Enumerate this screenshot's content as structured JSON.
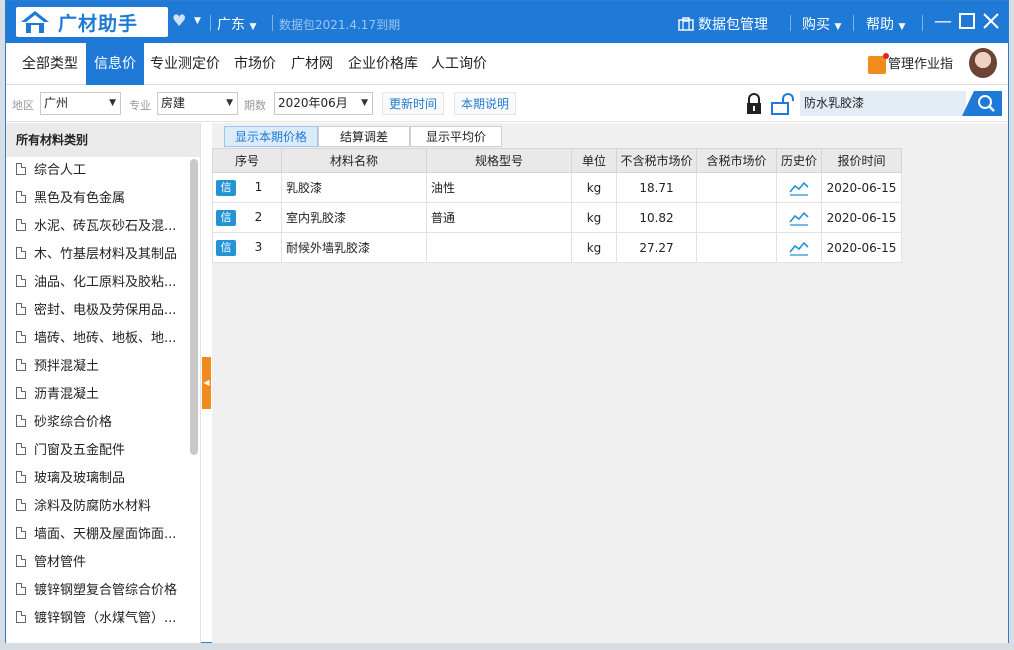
{
  "titlebar": {
    "app_name": "广材助手",
    "region": "广东",
    "datapkg_info": "数据包2021.4.17到期",
    "datapkg_mgmt": "数据包管理",
    "buy": "购买",
    "help": "帮助"
  },
  "nav": {
    "tabs": [
      {
        "label": "全部类型"
      },
      {
        "label": "信息价"
      },
      {
        "label": "专业测定价"
      },
      {
        "label": "市场价"
      },
      {
        "label": "广材网"
      },
      {
        "label": "企业价格库"
      },
      {
        "label": "人工询价"
      }
    ],
    "mgmt_label": "管理作业指"
  },
  "filters": {
    "region_label": "地区",
    "region_value": "广州",
    "major_label": "专业",
    "major_value": "房建",
    "period_label": "期数",
    "period_value": "2020年06月",
    "update_time": "更新时间",
    "period_note": "本期说明",
    "search_value": "防水乳胶漆"
  },
  "sidebar": {
    "header": "所有材料类别",
    "items": [
      {
        "label": "综合人工"
      },
      {
        "label": "黑色及有色金属"
      },
      {
        "label": "水泥、砖瓦灰砂石及混..."
      },
      {
        "label": "木、竹基层材料及其制品"
      },
      {
        "label": "油品、化工原料及胶粘..."
      },
      {
        "label": "密封、电极及劳保用品..."
      },
      {
        "label": "墙砖、地砖、地板、地..."
      },
      {
        "label": "预拌混凝土"
      },
      {
        "label": "沥青混凝土"
      },
      {
        "label": "砂浆综合价格"
      },
      {
        "label": "门窗及五金配件"
      },
      {
        "label": "玻璃及玻璃制品"
      },
      {
        "label": "涂料及防腐防水材料"
      },
      {
        "label": "墙面、天棚及屋面饰面..."
      },
      {
        "label": "管材管件"
      },
      {
        "label": "镀锌钢塑复合管综合价格"
      },
      {
        "label": "镀锌钢管（水煤气管）..."
      }
    ]
  },
  "subtabs": [
    {
      "label": "显示本期价格"
    },
    {
      "label": "结算调差"
    },
    {
      "label": "显示平均价"
    }
  ],
  "table": {
    "headers": [
      "序号",
      "材料名称",
      "规格型号",
      "单位",
      "不含税市场价",
      "含税市场价",
      "历史价",
      "报价时间"
    ],
    "badge": "信",
    "rows": [
      {
        "no": "1",
        "name": "乳胶漆",
        "spec": "油性",
        "unit": "kg",
        "price": "18.71",
        "tax_price": "",
        "date": "2020-06-15"
      },
      {
        "no": "2",
        "name": "室内乳胶漆",
        "spec": "普通",
        "unit": "kg",
        "price": "10.82",
        "tax_price": "",
        "date": "2020-06-15"
      },
      {
        "no": "3",
        "name": "耐候外墙乳胶漆",
        "spec": "",
        "unit": "kg",
        "price": "27.27",
        "tax_price": "",
        "date": "2020-06-15"
      }
    ]
  },
  "colors": {
    "brand": "#1e7ad6",
    "accent": "#f08c1c",
    "badge": "#2592d6"
  }
}
